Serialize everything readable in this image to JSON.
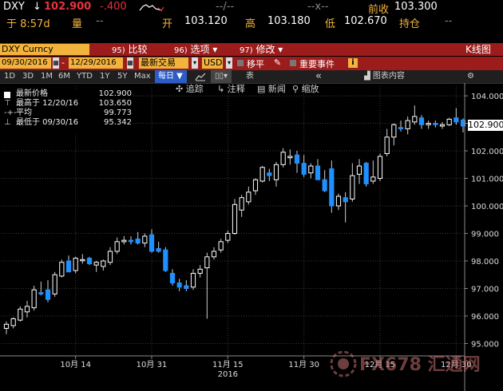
{
  "quote": {
    "ticker": "DXY",
    "last": "102.900",
    "change": "-.400",
    "dashes1": "--/--",
    "dashes2": "--x--",
    "prev_close_label": "前收",
    "prev_close": "103.300",
    "time": "于 8:57d",
    "volume_label": "量",
    "volume": "--",
    "open_label": "开",
    "open": "103.120",
    "high_label": "高",
    "high": "103.180",
    "low_label": "低",
    "low": "102.670",
    "position_label": "持仓",
    "position": "--"
  },
  "toolbar": {
    "security": "DXY Curncy",
    "compare_num": "95)",
    "compare_label": "比较",
    "options_num": "96)",
    "options_label": "选项",
    "edit_num": "97)",
    "edit_label": "修改",
    "chart_type": "K线图",
    "start_date": "09/30/2016",
    "end_date": "12/29/2016",
    "price_source": "最新交易",
    "currency": "USD",
    "moving_avg_label": "移平",
    "events_label": "重要事件",
    "info_badge": "i",
    "timeframes": [
      "1D",
      "3D",
      "1M",
      "6M",
      "YTD",
      "1Y",
      "5Y",
      "Max"
    ],
    "period": "每日",
    "table_label": "表",
    "chart_content_label": "图表内容",
    "track_label": "追踪",
    "annotate_label": "注释",
    "news_label": "新闻",
    "zoom_label": "缩放"
  },
  "legend": {
    "last_label": "最新价格",
    "last_value": "102.900",
    "high_label": "最高于 12/20/16",
    "high_value": "103.650",
    "avg_label": "平均",
    "avg_value": "99.773",
    "low_label": "最低于 09/30/16",
    "low_value": "95.342"
  },
  "price_tag": "102.900",
  "watermark_text": "FX678 汇通网",
  "colors": {
    "up": "#ffffff",
    "down": "#1e90ff",
    "accent": "#f2b33d",
    "toolbar": "#9c1c1c"
  },
  "chart_data": {
    "type": "candlestick",
    "yticks": [
      95,
      96,
      97,
      98,
      99,
      100,
      101,
      102,
      103,
      104
    ],
    "ytick_labels": [
      "95.000",
      "96.000",
      "97.000",
      "98.000",
      "99.000",
      "100.000",
      "101.000",
      "102.000",
      "103.000",
      "104.000"
    ],
    "ylim": [
      94.55,
      104.35
    ],
    "xticks": [
      {
        "label": "10月 14",
        "index": 10
      },
      {
        "label": "10月 31",
        "index": 21
      },
      {
        "label": "11月 15",
        "index": 32
      },
      {
        "label": "11月 30",
        "index": 43
      },
      {
        "label": "12月 15",
        "index": 54
      },
      {
        "label": "12月 30",
        "index": 65
      }
    ],
    "year_label": "2016",
    "candles": [
      {
        "o": 95.55,
        "h": 95.8,
        "l": 95.34,
        "c": 95.7
      },
      {
        "o": 95.65,
        "h": 95.95,
        "l": 95.55,
        "c": 95.9
      },
      {
        "o": 95.85,
        "h": 96.35,
        "l": 95.8,
        "c": 96.25
      },
      {
        "o": 96.15,
        "h": 96.55,
        "l": 95.95,
        "c": 96.35
      },
      {
        "o": 96.3,
        "h": 97.1,
        "l": 96.2,
        "c": 96.95
      },
      {
        "o": 96.85,
        "h": 97.25,
        "l": 96.75,
        "c": 96.8
      },
      {
        "o": 96.95,
        "h": 97.3,
        "l": 96.5,
        "c": 96.6
      },
      {
        "o": 96.8,
        "h": 97.6,
        "l": 96.7,
        "c": 97.5
      },
      {
        "o": 97.45,
        "h": 98.05,
        "l": 97.4,
        "c": 97.95
      },
      {
        "o": 98.0,
        "h": 98.2,
        "l": 97.6,
        "c": 97.6
      },
      {
        "o": 97.65,
        "h": 98.15,
        "l": 97.55,
        "c": 98.1
      },
      {
        "o": 98.05,
        "h": 98.25,
        "l": 97.9,
        "c": 98.05
      },
      {
        "o": 98.1,
        "h": 98.15,
        "l": 97.85,
        "c": 97.9
      },
      {
        "o": 97.85,
        "h": 98.0,
        "l": 97.6,
        "c": 97.95
      },
      {
        "o": 97.8,
        "h": 98.05,
        "l": 97.65,
        "c": 98.0
      },
      {
        "o": 97.95,
        "h": 98.5,
        "l": 97.85,
        "c": 98.35
      },
      {
        "o": 98.35,
        "h": 98.85,
        "l": 98.25,
        "c": 98.7
      },
      {
        "o": 98.7,
        "h": 98.9,
        "l": 98.6,
        "c": 98.75
      },
      {
        "o": 98.75,
        "h": 98.9,
        "l": 98.6,
        "c": 98.7
      },
      {
        "o": 98.8,
        "h": 99.05,
        "l": 98.6,
        "c": 98.65
      },
      {
        "o": 98.65,
        "h": 99.0,
        "l": 98.5,
        "c": 98.9
      },
      {
        "o": 98.95,
        "h": 99.15,
        "l": 98.3,
        "c": 98.35
      },
      {
        "o": 98.45,
        "h": 98.7,
        "l": 98.3,
        "c": 98.35
      },
      {
        "o": 98.4,
        "h": 98.5,
        "l": 97.6,
        "c": 97.65
      },
      {
        "o": 97.55,
        "h": 97.7,
        "l": 97.1,
        "c": 97.2
      },
      {
        "o": 97.2,
        "h": 97.35,
        "l": 96.9,
        "c": 97.05
      },
      {
        "o": 97.1,
        "h": 97.3,
        "l": 96.9,
        "c": 97.0
      },
      {
        "o": 97.05,
        "h": 97.7,
        "l": 96.95,
        "c": 97.55
      },
      {
        "o": 97.55,
        "h": 97.85,
        "l": 97.4,
        "c": 97.7
      },
      {
        "o": 97.75,
        "h": 98.3,
        "l": 95.9,
        "c": 98.15
      },
      {
        "o": 98.15,
        "h": 98.5,
        "l": 98.05,
        "c": 98.35
      },
      {
        "o": 98.4,
        "h": 98.8,
        "l": 98.3,
        "c": 98.7
      },
      {
        "o": 98.75,
        "h": 99.1,
        "l": 98.65,
        "c": 99.0
      },
      {
        "o": 99.0,
        "h": 100.25,
        "l": 98.95,
        "c": 100.05
      },
      {
        "o": 99.85,
        "h": 100.4,
        "l": 99.6,
        "c": 100.3
      },
      {
        "o": 100.15,
        "h": 100.7,
        "l": 100.05,
        "c": 100.5
      },
      {
        "o": 100.55,
        "h": 101.0,
        "l": 100.4,
        "c": 100.95
      },
      {
        "o": 100.9,
        "h": 101.45,
        "l": 100.85,
        "c": 101.4
      },
      {
        "o": 101.2,
        "h": 101.35,
        "l": 100.9,
        "c": 101.1
      },
      {
        "o": 100.95,
        "h": 101.6,
        "l": 100.7,
        "c": 101.5
      },
      {
        "o": 101.5,
        "h": 102.1,
        "l": 101.4,
        "c": 101.95
      },
      {
        "o": 101.75,
        "h": 102.05,
        "l": 101.5,
        "c": 101.8
      },
      {
        "o": 101.85,
        "h": 102.0,
        "l": 101.2,
        "c": 101.55
      },
      {
        "o": 101.55,
        "h": 101.85,
        "l": 101.05,
        "c": 101.15
      },
      {
        "o": 101.2,
        "h": 101.55,
        "l": 101.0,
        "c": 101.45
      },
      {
        "o": 101.45,
        "h": 101.7,
        "l": 100.95,
        "c": 100.95
      },
      {
        "o": 100.95,
        "h": 101.3,
        "l": 100.5,
        "c": 100.55
      },
      {
        "o": 101.35,
        "h": 101.65,
        "l": 99.75,
        "c": 100.0
      },
      {
        "o": 100.0,
        "h": 100.45,
        "l": 99.85,
        "c": 100.35
      },
      {
        "o": 100.3,
        "h": 100.5,
        "l": 99.4,
        "c": 100.15
      },
      {
        "o": 100.25,
        "h": 101.55,
        "l": 100.15,
        "c": 101.1
      },
      {
        "o": 101.15,
        "h": 101.7,
        "l": 100.8,
        "c": 101.45
      },
      {
        "o": 101.55,
        "h": 101.6,
        "l": 100.7,
        "c": 100.8
      },
      {
        "o": 100.9,
        "h": 101.65,
        "l": 100.8,
        "c": 101.05
      },
      {
        "o": 101.0,
        "h": 101.9,
        "l": 100.9,
        "c": 101.8
      },
      {
        "o": 101.9,
        "h": 102.8,
        "l": 101.8,
        "c": 102.5
      },
      {
        "o": 102.5,
        "h": 103.0,
        "l": 102.2,
        "c": 102.95
      },
      {
        "o": 102.85,
        "h": 103.1,
        "l": 102.7,
        "c": 102.8
      },
      {
        "o": 102.8,
        "h": 103.25,
        "l": 102.6,
        "c": 103.1
      },
      {
        "o": 103.05,
        "h": 103.65,
        "l": 102.95,
        "c": 103.25
      },
      {
        "o": 103.2,
        "h": 103.3,
        "l": 102.8,
        "c": 102.95
      },
      {
        "o": 102.95,
        "h": 103.1,
        "l": 102.8,
        "c": 103.0
      },
      {
        "o": 103.0,
        "h": 103.1,
        "l": 102.85,
        "c": 102.95
      },
      {
        "o": 102.9,
        "h": 103.05,
        "l": 102.8,
        "c": 102.95
      },
      {
        "o": 102.95,
        "h": 103.2,
        "l": 102.9,
        "c": 103.15
      },
      {
        "o": 103.2,
        "h": 103.55,
        "l": 102.95,
        "c": 103.05
      },
      {
        "o": 103.12,
        "h": 103.18,
        "l": 102.67,
        "c": 102.9
      }
    ]
  }
}
